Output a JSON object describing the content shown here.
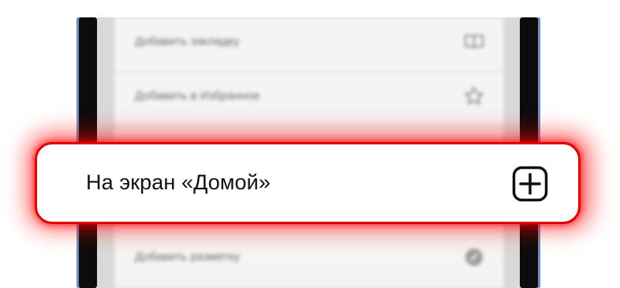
{
  "menu": {
    "items": [
      {
        "label": "Добавить закладку",
        "icon": "book-icon"
      },
      {
        "label": "Добавить в Избранное",
        "icon": "star-icon"
      },
      {
        "label": "",
        "icon": ""
      },
      {
        "label": "Добавить разметку",
        "icon": "markup-icon"
      }
    ]
  },
  "highlighted": {
    "label": "На экран «Домой»",
    "icon": "plus-square-icon",
    "outline_color": "#e00000"
  }
}
